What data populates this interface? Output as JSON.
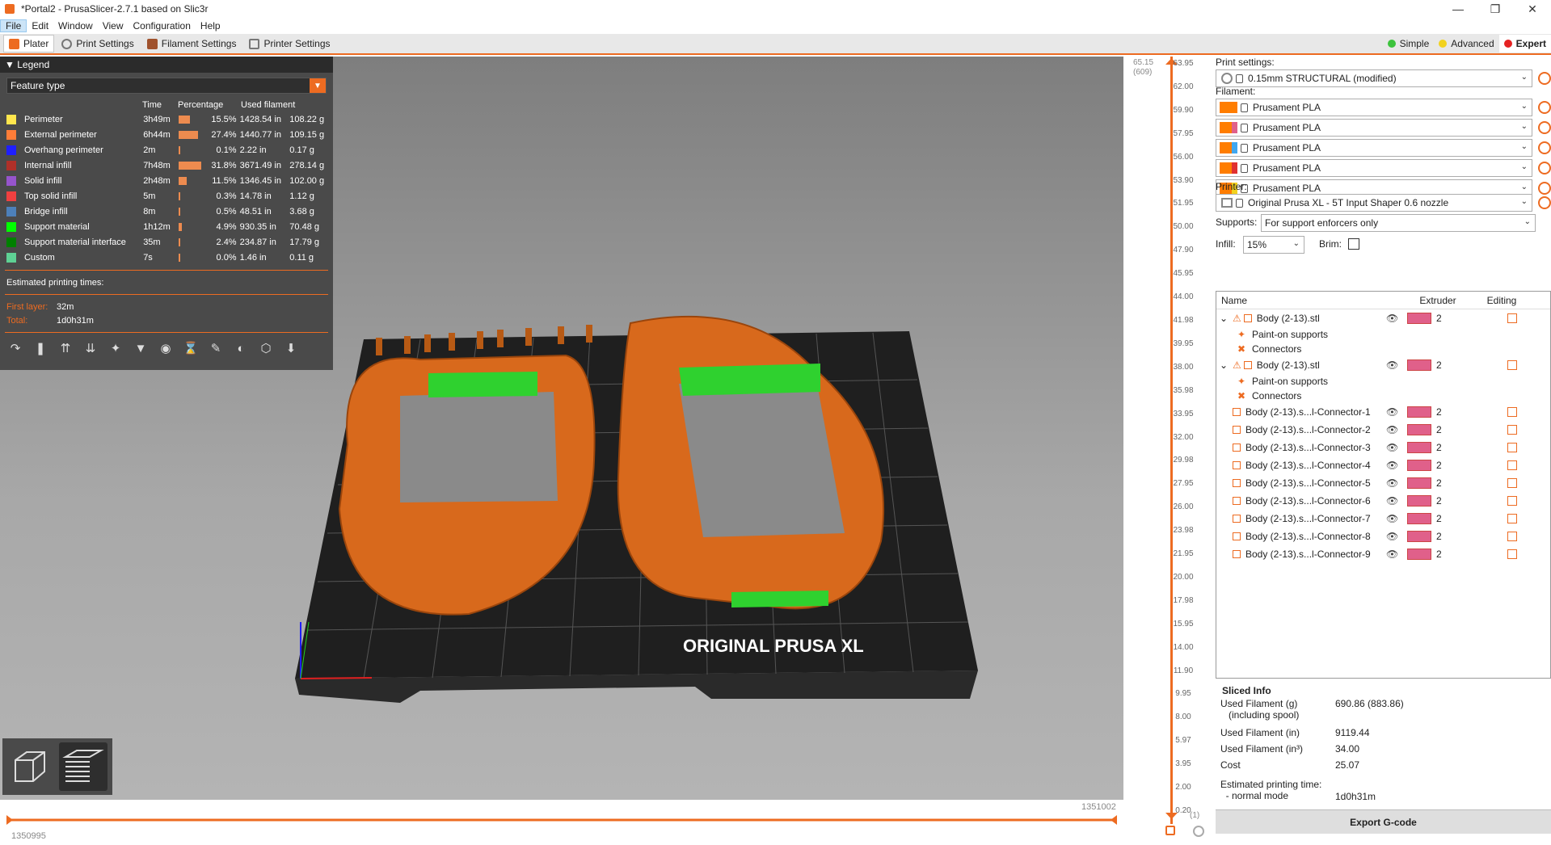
{
  "window": {
    "title": "*Portal2 - PrusaSlicer-2.7.1 based on Slic3r"
  },
  "menu": [
    "File",
    "Edit",
    "Window",
    "View",
    "Configuration",
    "Help"
  ],
  "tabs": [
    "Plater",
    "Print Settings",
    "Filament Settings",
    "Printer Settings"
  ],
  "modes": [
    {
      "label": "Simple",
      "color": "#3cc33c"
    },
    {
      "label": "Advanced",
      "color": "#f2d21e"
    },
    {
      "label": "Expert",
      "color": "#e52222"
    }
  ],
  "legend": {
    "title": "Legend",
    "view_type": "Feature type",
    "headers": {
      "time": "Time",
      "percentage": "Percentage",
      "used": "Used filament"
    },
    "rows": [
      {
        "name": "Perimeter",
        "color": "#ffe64d",
        "time": "3h49m",
        "pct": 0.155,
        "pct_label": "15.5%",
        "inches": "1428.54 in",
        "grams": "108.22 g"
      },
      {
        "name": "External perimeter",
        "color": "#ff7d38",
        "time": "6h44m",
        "pct": 0.274,
        "pct_label": "27.4%",
        "inches": "1440.77 in",
        "grams": "109.15 g"
      },
      {
        "name": "Overhang perimeter",
        "color": "#1f1fff",
        "time": "2m",
        "pct": 0.001,
        "pct_label": "0.1%",
        "inches": "2.22 in",
        "grams": "0.17 g"
      },
      {
        "name": "Internal infill",
        "color": "#b03029",
        "time": "7h48m",
        "pct": 0.318,
        "pct_label": "31.8%",
        "inches": "3671.49 in",
        "grams": "278.14 g"
      },
      {
        "name": "Solid infill",
        "color": "#9654cc",
        "time": "2h48m",
        "pct": 0.115,
        "pct_label": "11.5%",
        "inches": "1346.45 in",
        "grams": "102.00 g"
      },
      {
        "name": "Top solid infill",
        "color": "#f04040",
        "time": "5m",
        "pct": 0.003,
        "pct_label": "0.3%",
        "inches": "14.78 in",
        "grams": "1.12 g"
      },
      {
        "name": "Bridge infill",
        "color": "#4d80ba",
        "time": "8m",
        "pct": 0.005,
        "pct_label": "0.5%",
        "inches": "48.51 in",
        "grams": "3.68 g"
      },
      {
        "name": "Support material",
        "color": "#00ff00",
        "time": "1h12m",
        "pct": 0.049,
        "pct_label": "4.9%",
        "inches": "930.35 in",
        "grams": "70.48 g"
      },
      {
        "name": "Support material interface",
        "color": "#008000",
        "time": "35m",
        "pct": 0.024,
        "pct_label": "2.4%",
        "inches": "234.87 in",
        "grams": "17.79 g"
      },
      {
        "name": "Custom",
        "color": "#5ed194",
        "time": "7s",
        "pct": 0.0,
        "pct_label": "0.0%",
        "inches": "1.46 in",
        "grams": "0.11 g"
      }
    ],
    "est_title": "Estimated printing times:",
    "first_layer_label": "First layer:",
    "first_layer": "32m",
    "total_label": "Total:",
    "total": "1d0h31m"
  },
  "bed_label": "ORIGINAL PRUSA XL",
  "hslider": {
    "left": "1350995",
    "right": "1351002"
  },
  "vruler": {
    "top": "65.15",
    "top_sub": "(609)",
    "bottom_sub": "(1)",
    "ticks": [
      "63.95",
      "62.00",
      "59.90",
      "57.95",
      "56.00",
      "53.90",
      "51.95",
      "50.00",
      "47.90",
      "45.95",
      "44.00",
      "41.98",
      "39.95",
      "38.00",
      "35.98",
      "33.95",
      "32.00",
      "29.98",
      "27.95",
      "26.00",
      "23.98",
      "21.95",
      "20.00",
      "17.98",
      "15.95",
      "14.00",
      "11.90",
      "9.95",
      "8.00",
      "5.97",
      "3.95",
      "2.00",
      "0.20"
    ]
  },
  "right": {
    "print_settings_label": "Print settings:",
    "print_profile": "0.15mm STRUCTURAL (modified)",
    "filament_label": "Filament:",
    "filaments": [
      {
        "name": "Prusament PLA",
        "c1": "#ff7d00",
        "c2": "#ff7d00"
      },
      {
        "name": "Prusament PLA",
        "c1": "#ff7d00",
        "c2": "#e0608a"
      },
      {
        "name": "Prusament PLA",
        "c1": "#ff7d00",
        "c2": "#3fa7f0"
      },
      {
        "name": "Prusament PLA",
        "c1": "#ff7d00",
        "c2": "#e03030"
      },
      {
        "name": "Prusament PLA",
        "c1": "#ff7d00",
        "c2": "#f2d21e"
      }
    ],
    "printer_label": "Printer:",
    "printer": "Original Prusa XL - 5T Input Shaper 0.6 nozzle",
    "supports_label": "Supports:",
    "supports": "For support enforcers only",
    "infill_label": "Infill:",
    "infill": "15%",
    "brim_label": "Brim:",
    "objlist_headers": {
      "name": "Name",
      "extruder": "Extruder",
      "editing": "Editing"
    },
    "objects": [
      {
        "name": "Body (2-13).stl",
        "level": 0,
        "warn": true,
        "ext": "2"
      },
      {
        "name": "Paint-on supports",
        "level": 1
      },
      {
        "name": "Connectors",
        "level": 1
      },
      {
        "name": "Body (2-13).stl",
        "level": 0,
        "warn": true,
        "ext": "2"
      },
      {
        "name": "Paint-on supports",
        "level": 1
      },
      {
        "name": "Connectors",
        "level": 1
      },
      {
        "name": "Body (2-13).s...l-Connector-1",
        "level": 2,
        "ext": "2"
      },
      {
        "name": "Body (2-13).s...l-Connector-2",
        "level": 2,
        "ext": "2"
      },
      {
        "name": "Body (2-13).s...l-Connector-3",
        "level": 2,
        "ext": "2"
      },
      {
        "name": "Body (2-13).s...l-Connector-4",
        "level": 2,
        "ext": "2"
      },
      {
        "name": "Body (2-13).s...l-Connector-5",
        "level": 2,
        "ext": "2"
      },
      {
        "name": "Body (2-13).s...l-Connector-6",
        "level": 2,
        "ext": "2"
      },
      {
        "name": "Body (2-13).s...l-Connector-7",
        "level": 2,
        "ext": "2"
      },
      {
        "name": "Body (2-13).s...l-Connector-8",
        "level": 2,
        "ext": "2"
      },
      {
        "name": "Body (2-13).s...l-Connector-9",
        "level": 2,
        "ext": "2"
      }
    ],
    "sliced": {
      "title": "Sliced Info",
      "used_g_label": "Used Filament (g)",
      "used_g_sub": "(including spool)",
      "used_g": "690.86 (883.86)",
      "used_in_label": "Used Filament (in)",
      "used_in": "9119.44",
      "used_in3_label": "Used Filament (in³)",
      "used_in3": "34.00",
      "cost_label": "Cost",
      "cost": "25.07",
      "est_label": "Estimated printing time:",
      "mode_label": "- normal mode",
      "est": "1d0h31m"
    },
    "export_label": "Export G-code"
  }
}
